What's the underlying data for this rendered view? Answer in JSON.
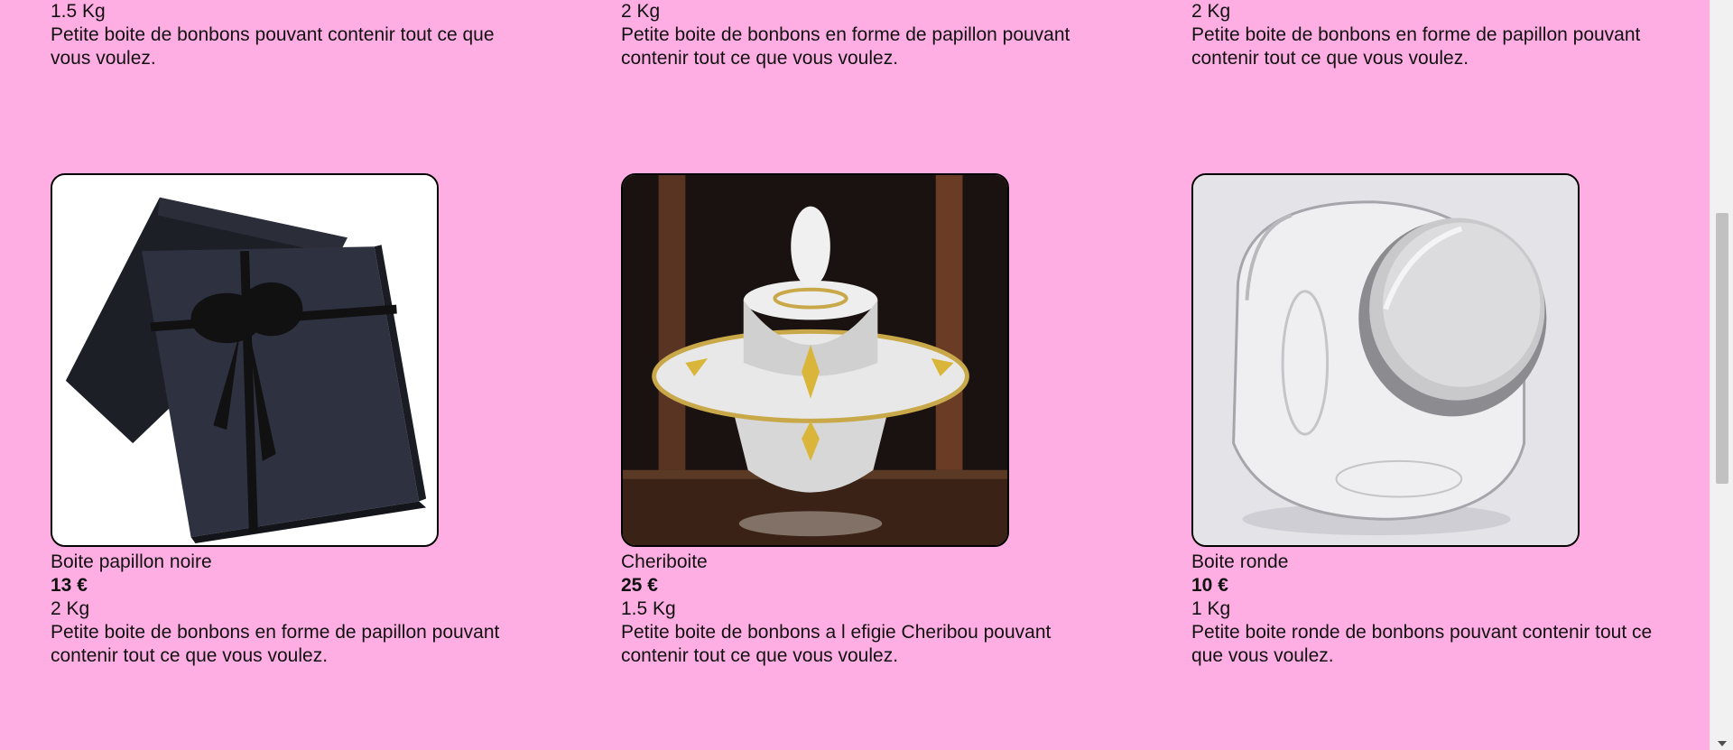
{
  "top_products": [
    {
      "weight": "1.5 Kg",
      "description": "Petite boite de bonbons pouvant contenir tout ce que vous voulez."
    },
    {
      "weight": "2 Kg",
      "description": "Petite boite de bonbons en forme de papillon pouvant contenir tout ce que vous voulez."
    },
    {
      "weight": "2 Kg",
      "description": "Petite boite de bonbons en forme de papillon pouvant contenir tout ce que vous voulez."
    }
  ],
  "products": [
    {
      "name": "Boite papillon noire",
      "price": "13 €",
      "weight": "2 Kg",
      "description": "Petite boite de bonbons en forme de papillon pouvant contenir tout ce que vous voulez.",
      "image": "black-gift-box-image"
    },
    {
      "name": "Cheriboite",
      "price": "25 €",
      "weight": "1.5 Kg",
      "description": "Petite boite de bonbons a l efigie Cheribou pouvant contenir tout ce que vous voulez.",
      "image": "crystal-candy-dish-image"
    },
    {
      "name": "Boite ronde",
      "price": "10 €",
      "weight": "1 Kg",
      "description": "Petite boite ronde de bonbons pouvant contenir tout ce que vous voulez.",
      "image": "glass-jar-image"
    }
  ],
  "theme": {
    "background": "#ffaee3"
  }
}
